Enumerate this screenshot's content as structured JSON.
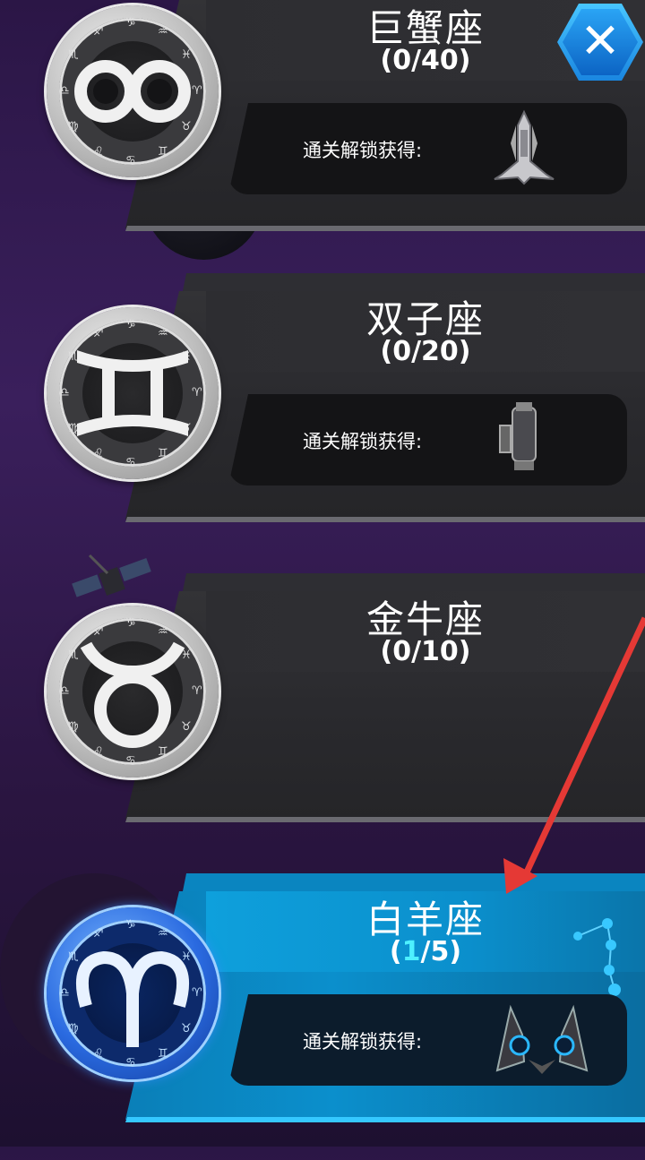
{
  "close_label": "✕",
  "reward_label": "通关解锁获得:",
  "cards": [
    {
      "title": "巨蟹座",
      "progress": "(0/40)",
      "sign": "cancer",
      "ship": "silver-fighter-icon",
      "active": false
    },
    {
      "title": "双子座",
      "progress": "(0/20)",
      "sign": "gemini",
      "ship": "turret-pod-icon",
      "active": false
    },
    {
      "title": "金牛座",
      "progress": "(0/10)",
      "sign": "taurus",
      "ship": "",
      "active": false
    },
    {
      "title": "白羊座",
      "progress_open": "(",
      "progress_current": "1",
      "progress_rest": "/5)",
      "sign": "aries",
      "ship": "twin-wing-drone-icon",
      "active": true
    }
  ],
  "ring_glyphs": [
    "♑",
    "♒",
    "♓",
    "♈",
    "♉",
    "♊",
    "♋",
    "♌",
    "♍",
    "♎",
    "♏",
    "♐"
  ],
  "colors": {
    "accent": "#0b8fcc",
    "highlight": "#4ef0ff",
    "arrow": "#e53935"
  }
}
